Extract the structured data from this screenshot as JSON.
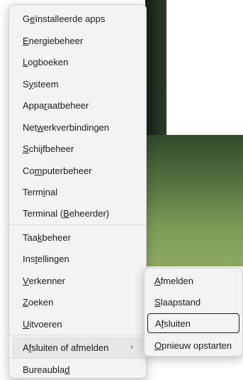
{
  "menu": {
    "items": [
      {
        "pre": "G",
        "u": "e",
        "post": "ïnstalleerde apps"
      },
      {
        "pre": "",
        "u": "E",
        "post": "nergiebeheer"
      },
      {
        "pre": "",
        "u": "L",
        "post": "ogboeken"
      },
      {
        "pre": "S",
        "u": "y",
        "post": "steem"
      },
      {
        "pre": "Appa",
        "u": "r",
        "post": "aatbeheer"
      },
      {
        "pre": "Net",
        "u": "w",
        "post": "erkverbindingen"
      },
      {
        "pre": "",
        "u": "S",
        "post": "chijfbeheer"
      },
      {
        "pre": "Co",
        "u": "m",
        "post": "puterbeheer"
      },
      {
        "pre": "Term",
        "u": "i",
        "post": "nal"
      },
      {
        "pre": "Terminal (",
        "u": "B",
        "post": "eheerder)"
      },
      {
        "pre": "Taa",
        "u": "k",
        "post": "beheer"
      },
      {
        "pre": "Ins",
        "u": "t",
        "post": "ellingen"
      },
      {
        "pre": "",
        "u": "V",
        "post": "erkenner"
      },
      {
        "pre": "",
        "u": "Z",
        "post": "oeken"
      },
      {
        "pre": "",
        "u": "U",
        "post": "itvoeren"
      },
      {
        "pre": "A",
        "u": "f",
        "post": "sluiten of afmelden"
      },
      {
        "pre": "Bureaubla",
        "u": "d",
        "post": ""
      }
    ],
    "chevron": "›"
  },
  "submenu": {
    "items": [
      {
        "pre": "",
        "u": "A",
        "post": "fmelden"
      },
      {
        "pre": "",
        "u": "S",
        "post": "laapstand"
      },
      {
        "pre": "A",
        "u": "f",
        "post": "sluiten"
      },
      {
        "pre": "",
        "u": "O",
        "post": "pnieuw opstarten"
      }
    ]
  }
}
